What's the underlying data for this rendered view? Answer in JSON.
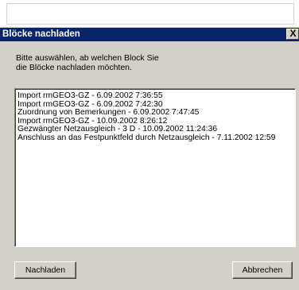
{
  "background": {
    "field_color": "#ffffff"
  },
  "dialog": {
    "title": "Blöcke nachladen",
    "close_glyph": "X",
    "titlebar_color": "#0a246a",
    "face_color": "#d4d0c8",
    "prompt_lines": [
      "Bitte auswählen, ab welchen Block Sie",
      "die Blöcke nachladen möchten."
    ],
    "list_items": [
      "Import rmGEO3-GZ  - 6.09.2002 7:36:55",
      "Import rmGEO3-GZ  - 6.09.2002 7:42:30",
      "Zuordnung von Bemerkungen  - 6.09.2002 7:47:45",
      "Import rmGEO3-GZ  - 10.09.2002 8:26:12",
      "Gezwängter Netzausgleich - 3 D  - 10.09.2002 11:24:36",
      "Anschluss an das Festpunktfeld  durch Netzausgleich  - 7.11.2002 12:59"
    ],
    "buttons": {
      "reload_label": "Nachladen",
      "cancel_label": "Abbrechen"
    }
  }
}
